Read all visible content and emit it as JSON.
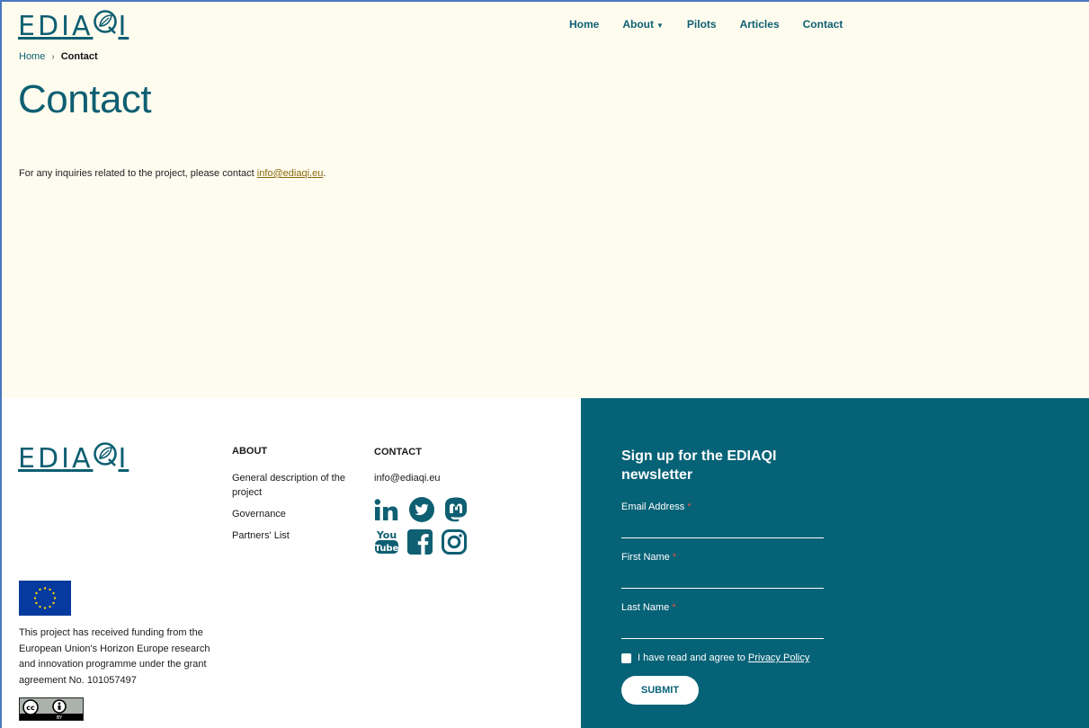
{
  "brand": {
    "logo_text": "EDIAQI",
    "color": "#0e5f72"
  },
  "nav": {
    "items": [
      "Home",
      "About",
      "Pilots",
      "Articles",
      "Contact"
    ]
  },
  "breadcrumb": {
    "home": "Home",
    "separator": "›",
    "current": "Contact"
  },
  "page": {
    "title": "Contact",
    "intro_prefix": "For any inquiries related to the project, please contact ",
    "intro_email": "info@ediaqi.eu",
    "intro_suffix": "."
  },
  "footer": {
    "about": {
      "heading": "ABOUT",
      "links": [
        "General description of the project",
        "Governance",
        "Partners' List"
      ]
    },
    "contact": {
      "heading": "CONTACT",
      "email": "info@ediaqi.eu",
      "socials": [
        "linkedin-icon",
        "twitter-icon",
        "mastodon-icon",
        "youtube-icon",
        "facebook-icon",
        "instagram-icon"
      ]
    },
    "funding_text": "This project has received funding from the European Union's Horizon Europe research and innovation programme under the grant agreement No. 101057497",
    "license": {
      "cc": "cc",
      "by": "BY"
    }
  },
  "newsletter": {
    "title": "Sign up for the EDIAQI newsletter",
    "email_label": "Email Address",
    "first_name_label": "First Name",
    "last_name_label": "Last Name",
    "required_mark": "*",
    "consent_text": "I have read and agree to",
    "privacy_link": "Privacy Policy",
    "submit_label": "SUBMIT",
    "bg_color": "#066277"
  }
}
